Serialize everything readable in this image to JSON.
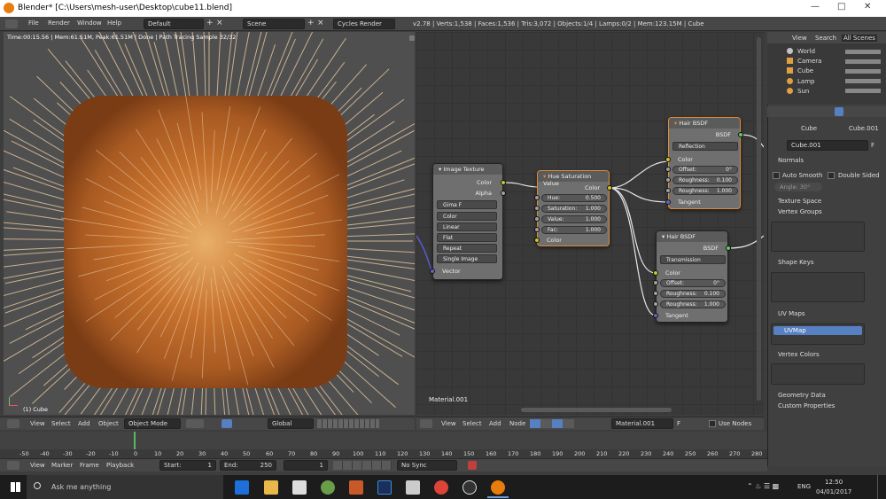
{
  "window": {
    "title": "Blender* [C:\\Users\\mesh-user\\Desktop\\cube11.blend]"
  },
  "menu": {
    "file": "File",
    "render": "Render",
    "window": "Window",
    "help": "Help"
  },
  "screen_layout": "Default",
  "scene": "Scene",
  "engine": "Cycles Render",
  "stats": "v2.78 | Verts:1,538 | Faces:1,536 | Tris:3,072 | Objects:1/4 | Lamps:0/2 | Mem:123.15M | Cube",
  "viewport": {
    "render_status": "Time:00:15.56 | Mem:61.51M, Peak:61.51M | Done | Path Tracing Sample 32/32",
    "object_label": "(1) Cube"
  },
  "node_editor": {
    "material_label": "Material.001"
  },
  "nodes": {
    "image_texture": {
      "title": "Image Texture",
      "out_color": "Color",
      "out_alpha": "Alpha",
      "image": "Gima",
      "fake": "F",
      "color": "Color",
      "interp": "Linear",
      "proj": "Flat",
      "ext": "Repeat",
      "source": "Single Image",
      "in_vector": "Vector"
    },
    "hue_sat": {
      "title": "Hue Saturation Value",
      "out_color": "Color",
      "hue_label": "Hue:",
      "hue": "0.500",
      "sat_label": "Saturation:",
      "sat": "1.000",
      "val_label": "Value:",
      "val": "1.000",
      "fac_label": "Fac:",
      "fac": "1.000",
      "in_color": "Color"
    },
    "hair1": {
      "title": "Hair BSDF",
      "out": "BSDF",
      "mode": "Reflection",
      "color": "Color",
      "offset_label": "Offset:",
      "offset": "0°",
      "r1_label": "Roughness:",
      "r1": "0.100",
      "r2_label": "Roughness:",
      "r2": "1.000",
      "tangent": "Tangent"
    },
    "hair2": {
      "title": "Hair BSDF",
      "out": "BSDF",
      "mode": "Transmission",
      "color": "Color",
      "offset_label": "Offset:",
      "offset": "0°",
      "r1_label": "Roughness:",
      "r1": "0.100",
      "r2_label": "Roughness:",
      "r2": "1.000",
      "tangent": "Tangent"
    }
  },
  "viewport_header": {
    "view": "View",
    "select": "Select",
    "add": "Add",
    "object": "Object",
    "mode": "Object Mode",
    "orientation": "Global"
  },
  "node_header": {
    "view": "View",
    "select": "Select",
    "add": "Add",
    "node": "Node",
    "material": "Material.001",
    "fake": "F",
    "use_nodes": "Use Nodes"
  },
  "timeline": {
    "ticks": [
      "-50",
      "-40",
      "-30",
      "-20",
      "-10",
      "0",
      "10",
      "20",
      "30",
      "40",
      "50",
      "60",
      "70",
      "80",
      "90",
      "100",
      "110",
      "120",
      "130",
      "140",
      "150",
      "160",
      "170",
      "180",
      "190",
      "200",
      "210",
      "220",
      "230",
      "240",
      "250",
      "260",
      "270",
      "280"
    ],
    "view": "View",
    "marker": "Marker",
    "frame": "Frame",
    "playback": "Playback",
    "start_label": "Start:",
    "start": "1",
    "end_label": "End:",
    "end": "250",
    "current": "1",
    "sync": "No Sync"
  },
  "outliner": {
    "tabs": [
      "View",
      "Search",
      "All Scenes"
    ],
    "items": [
      "World",
      "Camera",
      "Cube",
      "Lamp",
      "Sun"
    ]
  },
  "properties": {
    "breadcrumb_obj": "Cube",
    "breadcrumb_data": "Cube.001",
    "mesh_name": "Cube.001",
    "mesh_fake": "F",
    "normals": "Normals",
    "auto_smooth": "Auto Smooth",
    "double_sided": "Double Sided",
    "angle_label": "Angle:",
    "angle": "30°",
    "texture_space": "Texture Space",
    "vertex_groups": "Vertex Groups",
    "shape_keys": "Shape Keys",
    "uv_maps": "UV Maps",
    "uv_map_item": "UVMap",
    "vertex_colors": "Vertex Colors",
    "geometry_data": "Geometry Data",
    "custom_properties": "Custom Properties"
  },
  "taskbar": {
    "search": "Ask me anything",
    "lang": "ENG",
    "time": "12:50",
    "date": "04/01/2017"
  },
  "colors": {
    "accent_select": "#e08a38",
    "uv_highlight": "#5680c2",
    "socket_color": "#c7c729",
    "socket_float": "#a1a1a1",
    "socket_vector": "#6363c7",
    "socket_shader": "#62c862"
  }
}
